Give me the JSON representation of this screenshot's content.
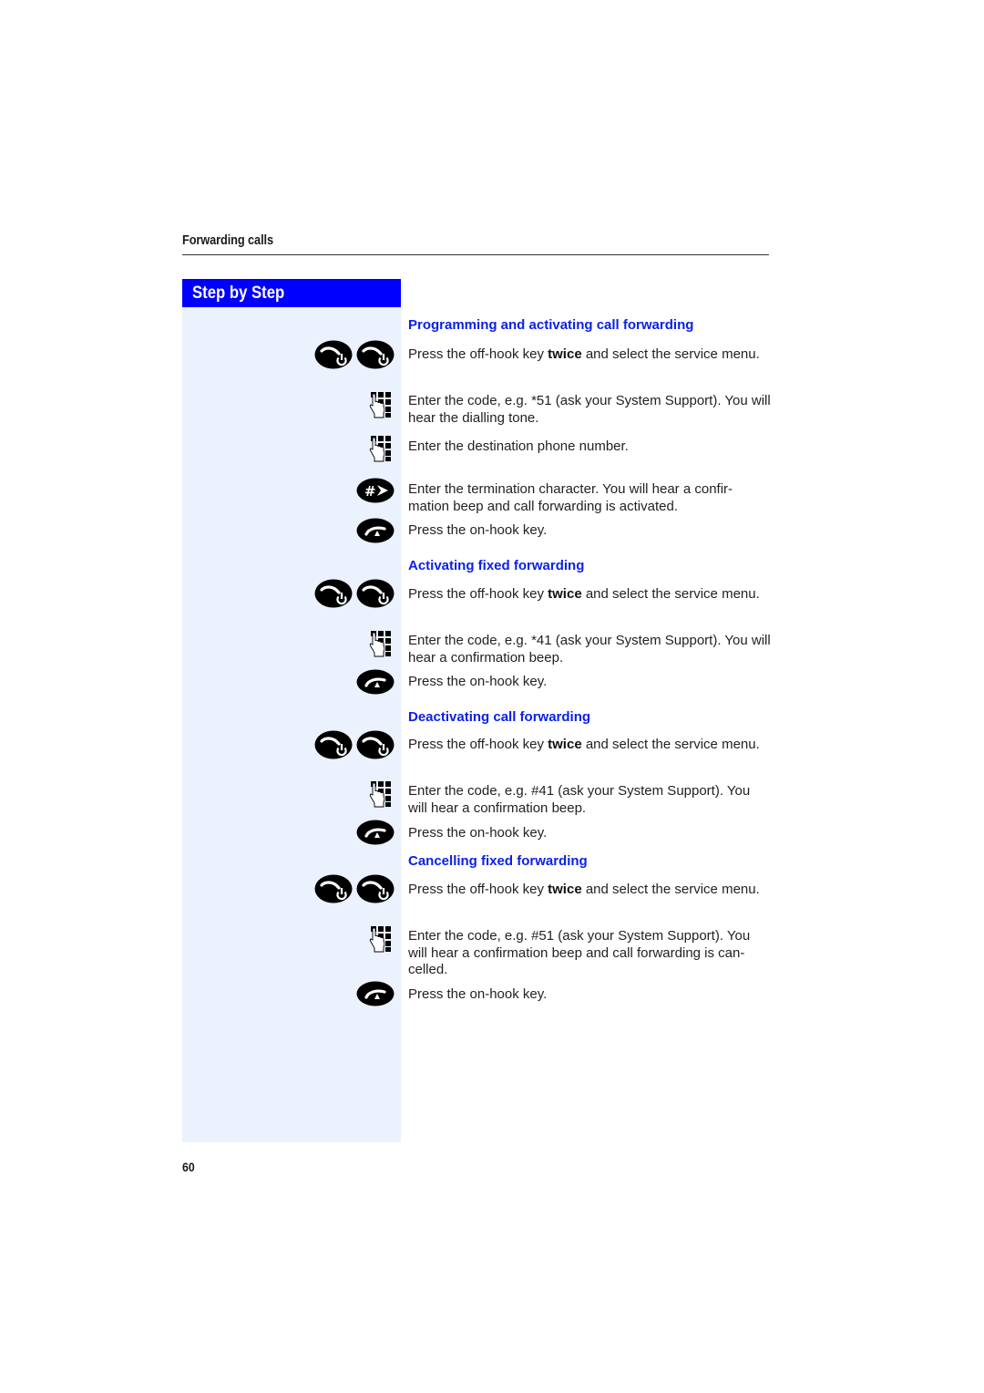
{
  "page": {
    "section_title": "Forwarding calls",
    "sidebar_title": "Step by Step",
    "page_number": "60",
    "accent_color": "#0000ff",
    "heading_color": "#0b21e8",
    "sidebar_bg": "#ebf2fe"
  },
  "sections": [
    {
      "heading": "Programming and activating call forwarding",
      "steps": [
        {
          "icon": "off-hook-key-twice",
          "text_pre": "Press the off-hook key ",
          "text_bold": "twice",
          "text_post": " and select the service menu."
        },
        {
          "icon": "keypad-entry",
          "text": "Enter the code, e.g. *51 (ask your System Support). You will hear the dialling tone."
        },
        {
          "icon": "keypad-entry",
          "text": "Enter the destination phone number."
        },
        {
          "icon": "hash-key",
          "text": "Enter the termination character. You will hear a confir-mation beep and call forwarding is activated."
        },
        {
          "icon": "on-hook-key",
          "text": "Press the on-hook key."
        }
      ]
    },
    {
      "heading": "Activating fixed forwarding",
      "steps": [
        {
          "icon": "off-hook-key-twice",
          "text_pre": "Press the off-hook key ",
          "text_bold": "twice",
          "text_post": " and select the service menu."
        },
        {
          "icon": "keypad-entry",
          "text": "Enter the code, e.g. *41 (ask your System Support). You will hear a confirmation beep."
        },
        {
          "icon": "on-hook-key",
          "text": "Press the on-hook key."
        }
      ]
    },
    {
      "heading": "Deactivating call forwarding",
      "steps": [
        {
          "icon": "off-hook-key-twice",
          "text_pre": "Press the off-hook key ",
          "text_bold": "twice",
          "text_post": " and select the service menu."
        },
        {
          "icon": "keypad-entry",
          "text": "Enter the code, e.g. #41 (ask your System Support). You will hear a confirmation beep."
        },
        {
          "icon": "on-hook-key",
          "text": "Press the on-hook key."
        }
      ]
    },
    {
      "heading": "Cancelling fixed forwarding",
      "steps": [
        {
          "icon": "off-hook-key-twice",
          "text_pre": "Press the off-hook key ",
          "text_bold": "twice",
          "text_post": " and select the service menu."
        },
        {
          "icon": "keypad-entry",
          "text": "Enter the code, e.g. #51 (ask your System Support). You will hear a confirmation beep and call forwarding is can-celled."
        },
        {
          "icon": "on-hook-key",
          "text": "Press the on-hook key."
        }
      ]
    }
  ]
}
